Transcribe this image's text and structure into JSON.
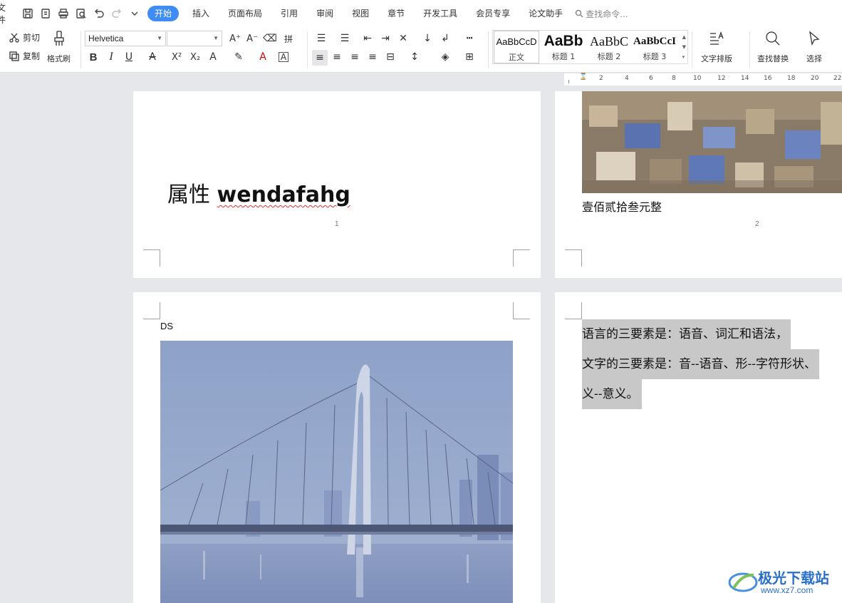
{
  "menubar": {
    "file_label": "文件",
    "tabs": [
      "开始",
      "插入",
      "页面布局",
      "引用",
      "审阅",
      "视图",
      "章节",
      "开发工具",
      "会员专享",
      "论文助手"
    ],
    "search_placeholder": "查找命令..."
  },
  "ribbon": {
    "clipboard": {
      "cut": "剪切",
      "copy": "复制",
      "format_painter": "格式刷"
    },
    "font_name": "Helvetica",
    "font_size": "",
    "styles": [
      {
        "preview": "AaBbCcD",
        "name": "正文"
      },
      {
        "preview": "AaBb",
        "name": "标题 1"
      },
      {
        "preview": "AaBbC",
        "name": "标题 2"
      },
      {
        "preview": "AaBbCcI",
        "name": "标题 3"
      }
    ],
    "text_layout": "文字排版",
    "find_replace": "查找替换",
    "select": "选择"
  },
  "ruler": {
    "labels": [
      "2",
      "4",
      "6",
      "8",
      "10",
      "12",
      "14",
      "16",
      "18",
      "20",
      "22"
    ]
  },
  "page1": {
    "title_cn": "属性",
    "title_en": "wendafahg",
    "page_number": "1"
  },
  "page2": {
    "caption": "壹佰贰拾叁元整",
    "page_number": "2"
  },
  "page3": {
    "label": "DS"
  },
  "page4": {
    "lines": [
      "语言的三要素是：语音、词汇和语法，",
      "文字的三要素是：音--语音、形--字符形状、",
      "义--意义。"
    ]
  },
  "watermark": {
    "name": "极光下载站",
    "url": "www.xz7.com"
  }
}
